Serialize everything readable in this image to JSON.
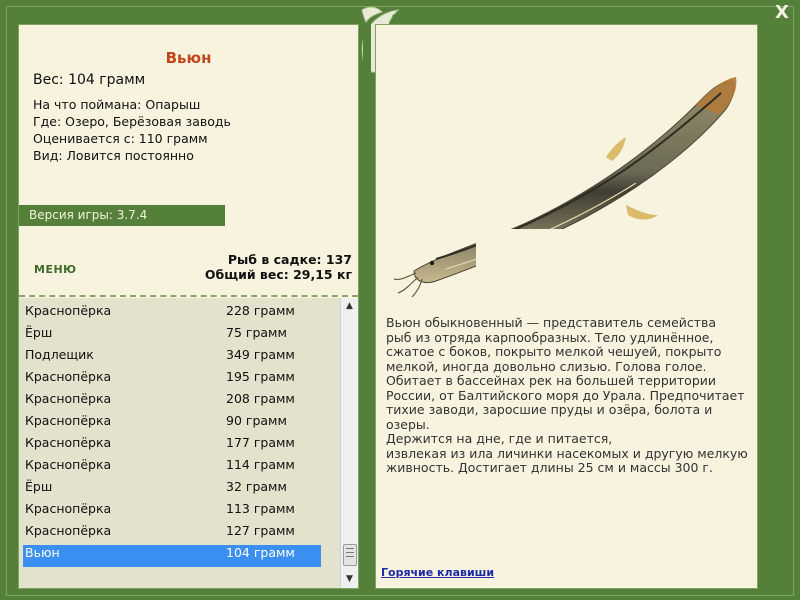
{
  "window": {
    "close_glyph": "X"
  },
  "fish": {
    "title": "Вьюн",
    "weight_line": "Вес: 104 грамм",
    "bait_line": "На что поймана: Опарыш",
    "place_line": "Где: Озеро, Берёзовая заводь",
    "value_line": "Оценивается с: 110 грамм",
    "kind_line": "Вид: Ловится постоянно"
  },
  "version": "Версия игры: 3.7.4",
  "menu_label": "МЕНЮ",
  "stats": {
    "count_line": "Рыб в садке: 137",
    "total_line": "Общий вес: 29,15 кг"
  },
  "catch_list": [
    {
      "name": "Краснопёрка",
      "weight": "228 грамм"
    },
    {
      "name": "Ёрш",
      "weight": "75 грамм"
    },
    {
      "name": "Подлещик",
      "weight": "349 грамм"
    },
    {
      "name": "Краснопёрка",
      "weight": "195 грамм"
    },
    {
      "name": "Краснопёрка",
      "weight": "208 грамм"
    },
    {
      "name": "Краснопёрка",
      "weight": "90 грамм"
    },
    {
      "name": "Краснопёрка",
      "weight": "177 грамм"
    },
    {
      "name": "Краснопёрка",
      "weight": "114 грамм"
    },
    {
      "name": "Ёрш",
      "weight": "32 грамм"
    },
    {
      "name": "Краснопёрка",
      "weight": "113 грамм"
    },
    {
      "name": "Краснопёрка",
      "weight": "127 грамм"
    },
    {
      "name": "Вьюн",
      "weight": "104 грамм",
      "selected": true
    }
  ],
  "description": [
    "Вьюн обыкновенный — представитель семейства",
    "рыб из отряда карпообразных. Тело удлинённое,",
    "сжатое с боков, покрыто мелкой чешуей, покрыто",
    "мелкой, иногда довольно слизью. Голова голое.",
    "Обитает в бассейнах рек на большей территории",
    "России, от Балтийского моря до Урала. Предпочитает",
    "тихие заводи, заросшие пруды и озёра, болота и озеры.",
    "Держится на дне, где и питается,",
    "извлекая из ила личинки насекомых и другую мелкую",
    "живность. Достигает длины 25 см и массы 300 г."
  ],
  "hotkeys_link": "Горячие клавиши",
  "colors": {
    "frame": "#55803a",
    "panel": "#f7f3df",
    "title": "#c2451b",
    "selected": "#3b8ff0",
    "link": "#1e2aa8"
  },
  "icons": {
    "close": "close-icon",
    "logo": "fish-logo-icon",
    "scroll_up": "scroll-up-icon",
    "scroll_down": "scroll-down-icon"
  }
}
